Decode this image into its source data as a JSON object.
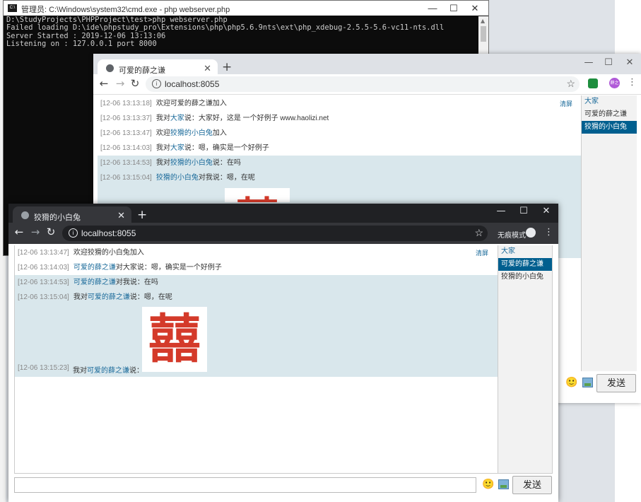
{
  "cmd": {
    "title": "管理员: C:\\Windows\\system32\\cmd.exe - php  webserver.php",
    "lines": [
      "D:\\StudyProjects\\PHPProject\\test>php webserver.php",
      "Failed loading D:\\ide\\phpstudy_pro\\Extensions\\php\\php5.6.9nts\\ext\\php_xdebug-2.5.5-5.6-vc11-nts.dll",
      "Server Started : 2019-12-06 13:13:06",
      "Listening on : 127.0.0.1 port 8000"
    ]
  },
  "winA": {
    "tab_title": "可爱的薛之谦",
    "url": "localhost:8055",
    "profile_badge": "薛之",
    "clear_label": "清屏",
    "messages": [
      {
        "ts": "[12-06 13:13:18]",
        "pre": "欢迎可爱的薛之谦加入",
        "name": "",
        "post": ""
      },
      {
        "ts": "[12-06 13:13:37]",
        "pre": "我对",
        "name": "大家",
        "post": "说：大家好，这是 一个好例子 www.haolizi.net"
      },
      {
        "ts": "[12-06 13:13:47]",
        "pre": "欢迎",
        "name": "狡猾的小白兔",
        "post": "加入"
      },
      {
        "ts": "[12-06 13:14:03]",
        "pre": "我对",
        "name": "大家",
        "post": "说：嗯，确实是一个好例子"
      },
      {
        "ts": "[12-06 13:14:53]",
        "pre": "我对",
        "name": "狡猾的小白兔",
        "post": "说：在吗"
      },
      {
        "ts": "[12-06 13:15:04]",
        "pre": "",
        "name": "狡猾的小白兔",
        "post": "对我说：嗯，在呢"
      }
    ],
    "users": [
      "大家",
      "可爱的薛之谦",
      "狡猾的小白兔"
    ],
    "send_label": "发送"
  },
  "winB": {
    "tab_title": "狡猾的小白兔",
    "url": "localhost:8055",
    "incognito_label": "无痕模式",
    "clear_label": "清屏",
    "messages": [
      {
        "ts": "[12-06 13:13:47]",
        "pre": "欢迎狡猾的小白兔加入",
        "name": "",
        "post": ""
      },
      {
        "ts": "[12-06 13:14:03]",
        "pre": "",
        "name": "可爱的薛之谦",
        "post": "对大家说：嗯，确实是一个好例子"
      },
      {
        "ts": "[12-06 13:14:53]",
        "pre": "",
        "name": "可爱的薛之谦",
        "post": "对我说：在吗"
      },
      {
        "ts": "[12-06 13:15:04]",
        "pre": "我对",
        "name": "可爱的薛之谦",
        "post": "说：嗯，在呢"
      },
      {
        "ts": "[12-06 13:15:23]",
        "pre": "我对",
        "name": "可爱的薛之谦",
        "post": "说："
      }
    ],
    "users": [
      "大家",
      "可爱的薛之谦",
      "狡猾的小白兔"
    ],
    "sticker_char": "囍",
    "send_label": "发送",
    "input_value": ""
  },
  "colors": {
    "link": "#1a6a9a",
    "highlight": "#d9e7ec",
    "selected_user": "#005f8f",
    "sticker_red": "#d43a2a"
  }
}
